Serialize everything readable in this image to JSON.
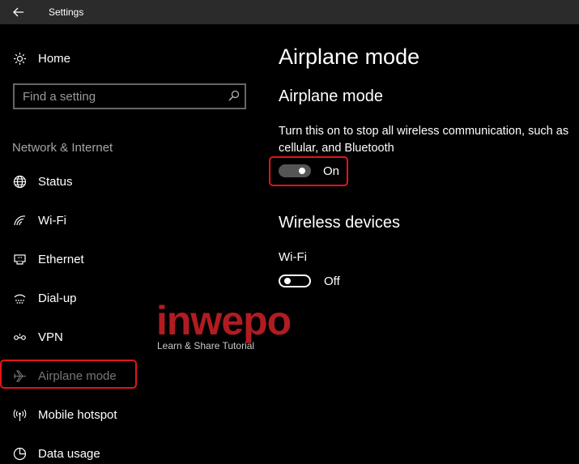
{
  "titlebar": {
    "title": "Settings"
  },
  "sidebar": {
    "home_label": "Home",
    "search_placeholder": "Find a setting",
    "section_header": "Network & Internet",
    "items": [
      {
        "label": "Status",
        "icon": "globe-icon"
      },
      {
        "label": "Wi-Fi",
        "icon": "wifi-icon"
      },
      {
        "label": "Ethernet",
        "icon": "ethernet-icon"
      },
      {
        "label": "Dial-up",
        "icon": "dialup-icon"
      },
      {
        "label": "VPN",
        "icon": "vpn-icon"
      },
      {
        "label": "Airplane mode",
        "icon": "airplane-icon",
        "selected": true
      },
      {
        "label": "Mobile hotspot",
        "icon": "hotspot-icon"
      },
      {
        "label": "Data usage",
        "icon": "data-usage-icon"
      }
    ]
  },
  "main": {
    "page_title": "Airplane mode",
    "airplane": {
      "heading": "Airplane mode",
      "description": "Turn this on to stop all wireless communication, such as cellular, and Bluetooth",
      "toggle_state": "On"
    },
    "wireless": {
      "heading": "Wireless devices",
      "wifi_label": "Wi-Fi",
      "wifi_state": "Off"
    }
  },
  "watermark": {
    "brand": "inwepo",
    "tagline": "Learn & Share Tutorial"
  },
  "colors": {
    "background": "#000000",
    "titlebar": "#2b2b2b",
    "highlight": "#e3141b",
    "watermark": "#b01c22"
  }
}
